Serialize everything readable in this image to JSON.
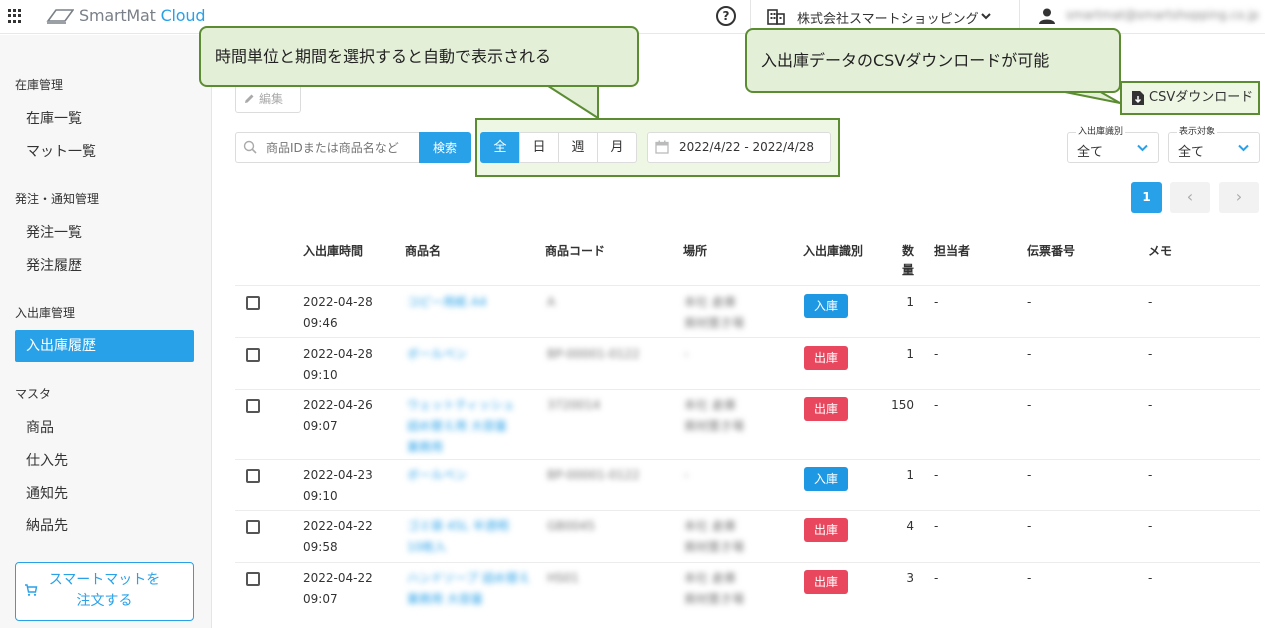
{
  "header": {
    "logo_main": "SmartMat ",
    "logo_accent": "Cloud",
    "help": "?",
    "company": "株式会社スマートショッピング",
    "user_email": "smartmat@smartshopping.co.jp"
  },
  "sidebar": {
    "sections": [
      {
        "title": "在庫管理",
        "items": [
          "在庫一覧",
          "マット一覧"
        ]
      },
      {
        "title": "発注・通知管理",
        "items": [
          "発注一覧",
          "発注履歴"
        ]
      },
      {
        "title": "入出庫管理",
        "items": [
          "入出庫履歴"
        ]
      },
      {
        "title": "マスタ",
        "items": [
          "商品",
          "仕入先",
          "通知先",
          "納品先"
        ]
      }
    ],
    "active_item": "入出庫履歴",
    "order_button_line1": "スマートマットを",
    "order_button_line2": "注文する"
  },
  "toolbar": {
    "edit_label": "編集",
    "csv_label": "CSVダウンロード",
    "search_placeholder": "商品IDまたは商品名など",
    "search_button": "検索",
    "period_buttons": [
      "全",
      "日",
      "週",
      "月"
    ],
    "period_active": "全",
    "date_range": "2022/4/22 - 2022/4/28",
    "type_filter_label": "入出庫識別",
    "type_filter_value": "全て",
    "display_filter_label": "表示対象",
    "display_filter_value": "全て"
  },
  "pager": {
    "current": "1",
    "prev": "‹",
    "next": "›"
  },
  "table": {
    "headers": {
      "time": "入出庫時間",
      "name": "商品名",
      "code": "商品コード",
      "place": "場所",
      "type": "入出庫識別",
      "qty_1": "数",
      "qty_2": "量",
      "person": "担当者",
      "slip": "伝票番号",
      "memo": "メモ"
    },
    "rows": [
      {
        "date": "2022-04-28",
        "time": "09:46",
        "name_1": "コピー用紙 A4",
        "name_2": "",
        "code": "A",
        "place_1": "本社 倉庫",
        "place_2": "資材置き場",
        "type": "入庫",
        "kind": "in",
        "qty": "1",
        "person": "-",
        "slip": "-",
        "memo": "-"
      },
      {
        "date": "2022-04-28",
        "time": "09:10",
        "name_1": "ボールペン",
        "name_2": "",
        "code": "BP-00001-0122",
        "place_1": "-",
        "place_2": "",
        "type": "出庫",
        "kind": "out",
        "qty": "1",
        "person": "-",
        "slip": "-",
        "memo": "-"
      },
      {
        "date": "2022-04-26",
        "time": "09:07",
        "name_1": "ウェットティッシュ",
        "name_2": "詰め替え用 大容量",
        "name_3": "業務用",
        "code": "3720014",
        "place_1": "本社 倉庫",
        "place_2": "資材置き場",
        "type": "出庫",
        "kind": "out",
        "qty": "150",
        "person": "-",
        "slip": "-",
        "memo": "-"
      },
      {
        "date": "2022-04-23",
        "time": "09:10",
        "name_1": "ボールペン",
        "name_2": "",
        "code": "BP-00001-0122",
        "place_1": "-",
        "place_2": "",
        "type": "入庫",
        "kind": "in",
        "qty": "1",
        "person": "-",
        "slip": "-",
        "memo": "-"
      },
      {
        "date": "2022-04-22",
        "time": "09:58",
        "name_1": "ゴミ袋 45L 半透明",
        "name_2": "10枚入",
        "code": "GB0045",
        "place_1": "本社 倉庫",
        "place_2": "資材置き場",
        "type": "出庫",
        "kind": "out",
        "qty": "4",
        "person": "-",
        "slip": "-",
        "memo": "-"
      },
      {
        "date": "2022-04-22",
        "time": "09:07",
        "name_1": "ハンドソープ 詰め替え",
        "name_2": "業務用 大容量",
        "code": "HS01",
        "place_1": "本社 倉庫",
        "place_2": "資材置き場",
        "type": "出庫",
        "kind": "out",
        "qty": "3",
        "person": "-",
        "slip": "-",
        "memo": "-"
      }
    ]
  },
  "callouts": {
    "left": "時間単位と期間を選択すると自動で表示される",
    "right": "入出庫データのCSVダウンロードが可能"
  },
  "colors": {
    "accent": "#29a1e8",
    "in": "#1f98e3",
    "out": "#e8475e",
    "callout_border": "#5b8c32",
    "callout_fill": "#e4efd8"
  }
}
